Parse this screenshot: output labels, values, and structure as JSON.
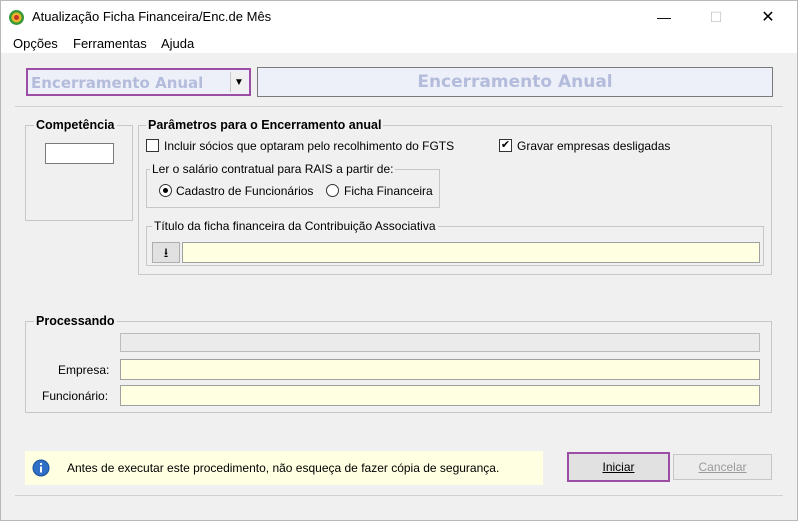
{
  "window": {
    "title": "Atualização Ficha Financeira/Enc.de Mês",
    "minimize": "—",
    "maximize": "☐",
    "close": "✕"
  },
  "menu": [
    "Opções",
    "Ferramentas",
    "Ajuda"
  ],
  "header": {
    "mode_selected": "Encerramento Anual",
    "dropdown_arrow": "▼",
    "banner": "Encerramento Anual"
  },
  "competencia": {
    "label": "Competência",
    "value": ""
  },
  "parametros": {
    "label": "Parâmetros para o Encerramento anual",
    "incluir_socios": {
      "label": "Incluir sócios que optaram pelo recolhimento do FGTS",
      "checked": false
    },
    "gravar_desligadas": {
      "label": "Gravar empresas desligadas",
      "checked": true,
      "mark": "✔"
    },
    "rais": {
      "label": "Ler o salário contratual para RAIS a partir de:",
      "options": [
        "Cadastro de Funcionários",
        "Ficha Financeira"
      ],
      "selected": "Cadastro de Funcionários"
    },
    "titulo": {
      "label": "Título da ficha financeira da Contribuição Associativa",
      "button_icon": "⭳",
      "value": ""
    }
  },
  "processando": {
    "label": "Processando",
    "empresa_label": "Empresa:",
    "funcionario_label": "Funcionário:",
    "empresa_value": "",
    "funcionario_value": ""
  },
  "info": {
    "icon": "i",
    "text": "Antes de executar este procedimento, não esqueça de fazer cópia de segurança."
  },
  "buttons": {
    "iniciar": "Iniciar",
    "cancelar": "Cancelar"
  },
  "colors": {
    "highlight_border": "#9b4ea3",
    "banner_text": "#b4bcdc",
    "info_bg": "#ffffe1",
    "info_icon": "#2f6fc6"
  }
}
